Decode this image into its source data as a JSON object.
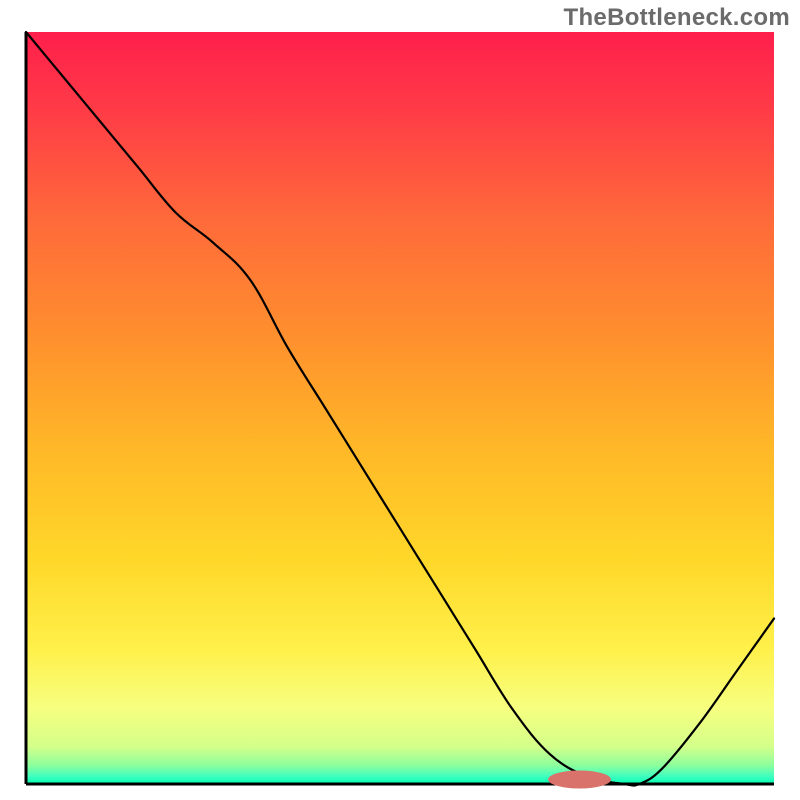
{
  "watermark": "TheBottleneck.com",
  "chart_data": {
    "type": "line",
    "title": "",
    "xlabel": "",
    "ylabel": "",
    "xlim": [
      0,
      100
    ],
    "ylim": [
      0,
      100
    ],
    "grid": false,
    "legend": false,
    "annotations": [],
    "x": [
      0,
      5,
      10,
      15,
      20,
      25,
      30,
      35,
      40,
      45,
      50,
      55,
      60,
      65,
      70,
      75,
      80,
      82,
      85,
      90,
      95,
      100
    ],
    "values": [
      100,
      94,
      88,
      82,
      76,
      72,
      67,
      58,
      50,
      42,
      34,
      26,
      18,
      10,
      4,
      1,
      0,
      0,
      2,
      8,
      15,
      22
    ],
    "marker": {
      "x": 74,
      "y": 0.6,
      "rx": 4.2,
      "ry": 1.2,
      "color": "#d9726b"
    },
    "gradient_stops": [
      {
        "offset": 0.0,
        "color": "#ff1f4c"
      },
      {
        "offset": 0.1,
        "color": "#ff3a47"
      },
      {
        "offset": 0.25,
        "color": "#ff6a3a"
      },
      {
        "offset": 0.4,
        "color": "#ff8e2e"
      },
      {
        "offset": 0.55,
        "color": "#ffb728"
      },
      {
        "offset": 0.7,
        "color": "#ffd729"
      },
      {
        "offset": 0.82,
        "color": "#fff04a"
      },
      {
        "offset": 0.9,
        "color": "#f6ff80"
      },
      {
        "offset": 0.95,
        "color": "#d4ff8a"
      },
      {
        "offset": 0.975,
        "color": "#8dff9c"
      },
      {
        "offset": 0.99,
        "color": "#3effc0"
      },
      {
        "offset": 1.0,
        "color": "#00ffb0"
      }
    ],
    "axis_color": "#000000",
    "line_color": "#000000",
    "line_width": 2.2
  }
}
